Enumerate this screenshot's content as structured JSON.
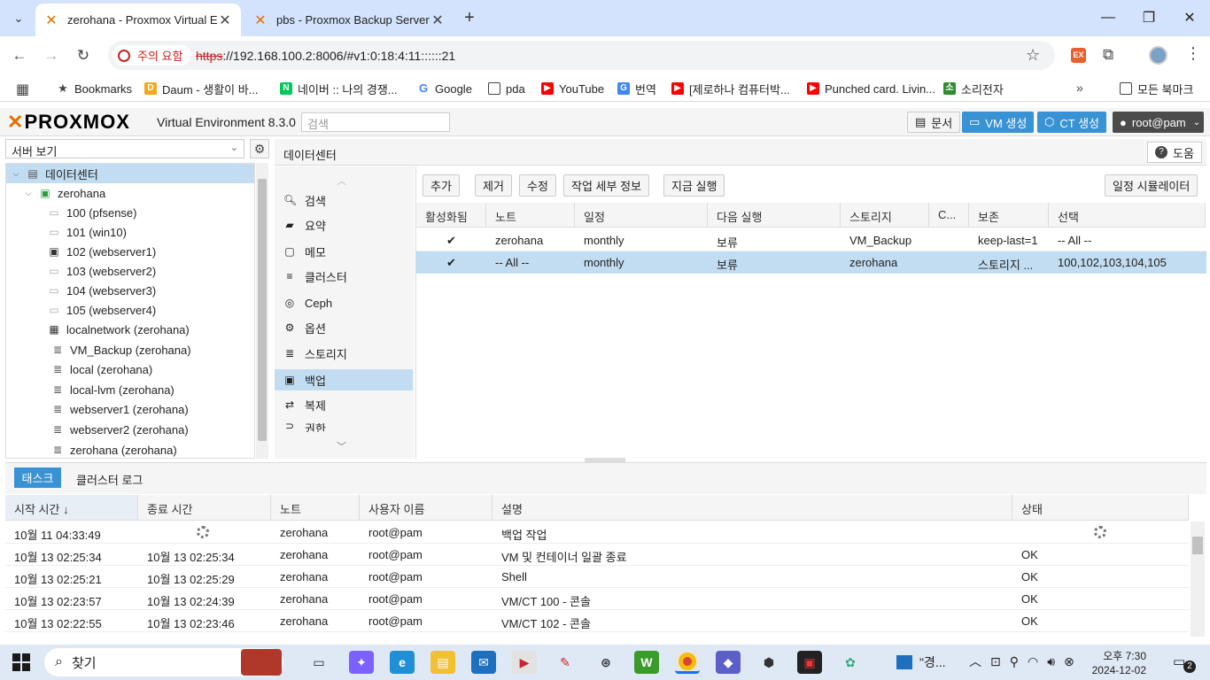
{
  "browser": {
    "tabs": [
      {
        "title": "zerohana - Proxmox Virtual En",
        "active": true
      },
      {
        "title": "pbs - Proxmox Backup Server",
        "active": false
      }
    ],
    "security_label": "주의 요함",
    "url_scheme": "https",
    "url_rest": "://192.168.100.2:8006/#v1:0:18:4:11::::::21",
    "bookmarks": [
      "Bookmarks",
      "Daum - 생활이 바...",
      "네이버 :: 나의 경쟁...",
      "Google",
      "pda",
      "YouTube",
      "번역",
      "[제로하나 컴퓨터박...",
      "Punched card. Livin...",
      "소리전자"
    ],
    "all_bookmarks": "모든 북마크"
  },
  "pve": {
    "logo_a": "PRO",
    "logo_x": "X",
    "logo_b": "MO",
    "logo_c": "X",
    "version": "Virtual Environment 8.3.0",
    "search_placeholder": "검색",
    "docs_label": "문서",
    "create_vm": "VM 생성",
    "create_ct": "CT 생성",
    "user": "root@pam",
    "view_selector": "서버 보기",
    "tree": [
      {
        "label": "데이터센터",
        "icon": "datacenter-icon",
        "level": 0,
        "selected": true
      },
      {
        "label": "zerohana",
        "icon": "node-icon",
        "level": 1
      },
      {
        "label": "100 (pfsense)",
        "icon": "vm-icon",
        "level": 2
      },
      {
        "label": "101 (win10)",
        "icon": "vm-icon",
        "level": 2
      },
      {
        "label": "102 (webserver1)",
        "icon": "vm-running-icon",
        "level": 2
      },
      {
        "label": "103 (webserver2)",
        "icon": "vm-icon",
        "level": 2
      },
      {
        "label": "104 (webserver3)",
        "icon": "vm-icon",
        "level": 2
      },
      {
        "label": "105 (webserver4)",
        "icon": "vm-icon",
        "level": 2
      },
      {
        "label": "localnetwork (zerohana)",
        "icon": "network-icon",
        "level": 2
      },
      {
        "label": "VM_Backup (zerohana)",
        "icon": "storage-icon",
        "level": 2
      },
      {
        "label": "local (zerohana)",
        "icon": "storage-icon",
        "level": 2
      },
      {
        "label": "local-lvm (zerohana)",
        "icon": "storage-icon",
        "level": 2
      },
      {
        "label": "webserver1 (zerohana)",
        "icon": "storage-icon",
        "level": 2
      },
      {
        "label": "webserver2 (zerohana)",
        "icon": "storage-icon",
        "level": 2
      },
      {
        "label": "zerohana (zerohana)",
        "icon": "storage-icon",
        "level": 2
      }
    ],
    "panel_title": "데이터센터",
    "help_label": "도움",
    "menu": [
      {
        "label": "검색",
        "icon": "search-icon"
      },
      {
        "label": "요약",
        "icon": "book-icon"
      },
      {
        "label": "메모",
        "icon": "note-icon"
      },
      {
        "label": "클러스터",
        "icon": "server-icon"
      },
      {
        "label": "Ceph",
        "icon": "ceph-icon"
      },
      {
        "label": "옵션",
        "icon": "gear-icon"
      },
      {
        "label": "스토리지",
        "icon": "database-icon"
      },
      {
        "label": "백업",
        "icon": "floppy-icon",
        "selected": true
      },
      {
        "label": "복제",
        "icon": "retweet-icon"
      },
      {
        "label": "권한",
        "icon": "unlock-icon"
      }
    ],
    "toolbar": {
      "add": "추가",
      "remove": "제거",
      "edit": "수정",
      "job_detail": "작업 세부 정보",
      "run_now": "지금 실행",
      "schedule_sim": "일정 시뮬레이터"
    },
    "backup_columns": [
      "활성화됨",
      "노트",
      "일정",
      "다음 실행",
      "스토리지",
      "C...",
      "보존",
      "선택"
    ],
    "backup_jobs": [
      {
        "enabled": "✔",
        "node": "zerohana",
        "schedule": "monthly",
        "next_run": "보류",
        "storage": "VM_Backup",
        "comment": "",
        "retention": "keep-last=1",
        "selection": "-- All --"
      },
      {
        "enabled": "✔",
        "node": "-- All --",
        "schedule": "monthly",
        "next_run": "보류",
        "storage": "zerohana",
        "comment": "",
        "retention": "스토리지 ...",
        "selection": "100,102,103,104,105",
        "selected": true
      }
    ],
    "log_tabs": {
      "tasks": "태스크",
      "cluster_log": "클러스터 로그"
    },
    "task_columns": [
      "시작 시간 ↓",
      "종료 시간",
      "노트",
      "사용자 이름",
      "설명",
      "상태"
    ],
    "tasks": [
      {
        "start": "10월 11 04:33:49",
        "end": "",
        "node": "zerohana",
        "user": "root@pam",
        "desc": "백업 작업",
        "status": "",
        "running": true
      },
      {
        "start": "10월 13 02:25:34",
        "end": "10월 13 02:25:34",
        "node": "zerohana",
        "user": "root@pam",
        "desc": "VM 및 컨테이너 일괄 종료",
        "status": "OK"
      },
      {
        "start": "10월 13 02:25:21",
        "end": "10월 13 02:25:29",
        "node": "zerohana",
        "user": "root@pam",
        "desc": "Shell",
        "status": "OK"
      },
      {
        "start": "10월 13 02:23:57",
        "end": "10월 13 02:24:39",
        "node": "zerohana",
        "user": "root@pam",
        "desc": "VM/CT 100 - 콘솔",
        "status": "OK"
      },
      {
        "start": "10월 13 02:22:55",
        "end": "10월 13 02:23:46",
        "node": "zerohana",
        "user": "root@pam",
        "desc": "VM/CT 102 - 콘솔",
        "status": "OK"
      }
    ]
  },
  "taskbar": {
    "search": "찾기",
    "pinned_item": "\"경...",
    "time": "오후 7:30",
    "date": "2024-12-02",
    "notification_count": "2"
  },
  "colors": {
    "accent": "#3892d4",
    "selected_row": "#c2ddf2",
    "proxmox_orange": "#e57000"
  }
}
